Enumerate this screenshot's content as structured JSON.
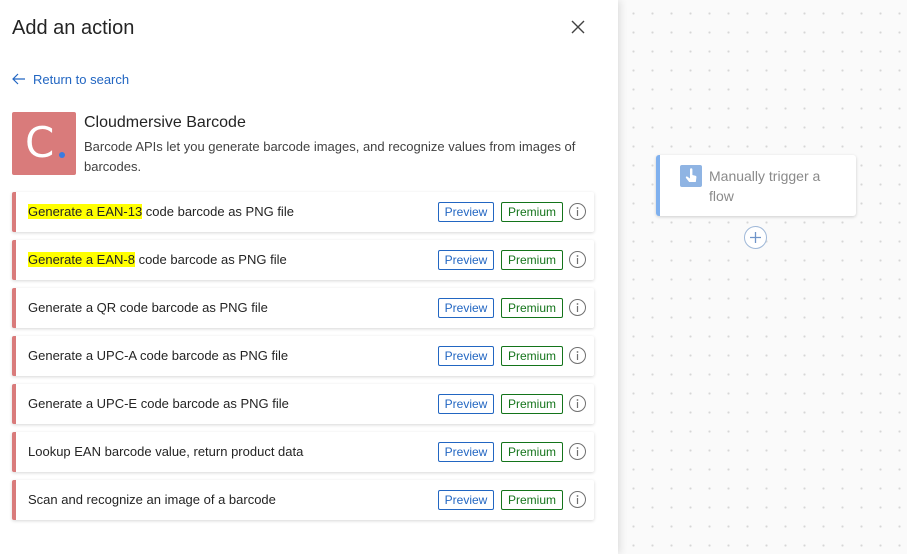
{
  "panel": {
    "title": "Add an action",
    "back_label": "Return to search"
  },
  "connector": {
    "logo_letter": "C",
    "name": "Cloudmersive Barcode",
    "description": "Barcode APIs let you generate barcode images, and recognize values from images of barcodes.",
    "accent_color": "#d97b7b"
  },
  "badges": {
    "preview": "Preview",
    "premium": "Premium"
  },
  "actions": [
    {
      "highlight": "Generate a EAN-13",
      "rest": " code barcode as PNG file"
    },
    {
      "highlight": "Generate a EAN-8",
      "rest": " code barcode as PNG file"
    },
    {
      "highlight": "",
      "rest": "Generate a QR code barcode as PNG file"
    },
    {
      "highlight": "",
      "rest": "Generate a UPC-A code barcode as PNG file"
    },
    {
      "highlight": "",
      "rest": "Generate a UPC-E code barcode as PNG file"
    },
    {
      "highlight": "",
      "rest": "Lookup EAN barcode value, return product data"
    },
    {
      "highlight": "",
      "rest": "Scan and recognize an image of a barcode"
    }
  ],
  "canvas": {
    "trigger_label": "Manually trigger a flow"
  },
  "icons": {
    "close": "close-icon",
    "back": "arrow-left-icon",
    "info": "info-icon",
    "trigger": "touch-hand-icon",
    "add": "plus-circle-icon"
  },
  "colors": {
    "link": "#2266c2",
    "premium": "#13741a",
    "highlight": "#ffff00"
  }
}
